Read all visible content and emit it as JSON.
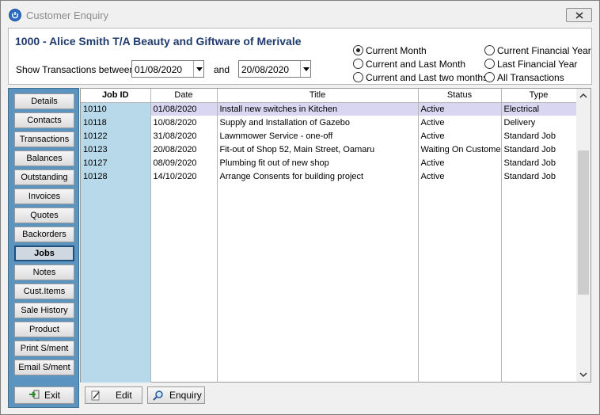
{
  "window": {
    "title": "Customer Enquiry"
  },
  "header": {
    "customer_title": "1000 - Alice Smith T/A Beauty and Giftware of Merivale",
    "show_label": "Show Transactions between",
    "from_date": "01/08/2020",
    "and_label": "and",
    "to_date": "20/08/2020"
  },
  "periods": [
    {
      "label": "Current Month",
      "selected": true
    },
    {
      "label": "Current and Last Month",
      "selected": false
    },
    {
      "label": "Current and Last two months",
      "selected": false
    },
    {
      "label": "Current Financial Year",
      "selected": false
    },
    {
      "label": "Last Financial Year",
      "selected": false
    },
    {
      "label": "All Transactions",
      "selected": false
    }
  ],
  "nav": {
    "items": [
      "Details",
      "Contacts",
      "Transactions",
      "Balances",
      "Outstanding",
      "Invoices",
      "Quotes",
      "Backorders",
      "Jobs",
      "Notes",
      "Cust.Items",
      "Sale History",
      "Product History",
      "Print S/ment",
      "Email S/ment"
    ],
    "active": "Jobs",
    "exit_label": "Exit"
  },
  "grid": {
    "columns": [
      "Job ID",
      "Date",
      "Title",
      "Status",
      "Type"
    ],
    "rows": [
      [
        "10110",
        "01/08/2020",
        "Install new switches in Kitchen",
        "Active",
        "Electrical"
      ],
      [
        "10118",
        "10/08/2020",
        "Supply and Installation of Gazebo",
        "Active",
        "Delivery"
      ],
      [
        "10122",
        "31/08/2020",
        "Lawnmower Service - one-off",
        "Active",
        "Standard Job"
      ],
      [
        "10123",
        "20/08/2020",
        "Fit-out of Shop 52, Main Street, Oamaru",
        "Waiting On Customer",
        "Standard Job"
      ],
      [
        "10127",
        "08/09/2020",
        "Plumbing fit out of new shop",
        "Active",
        "Standard Job"
      ],
      [
        "10128",
        "14/10/2020",
        "Arrange Consents for building project",
        "Active",
        "Standard Job"
      ]
    ],
    "selected_row": 0
  },
  "toolbar": {
    "edit_label": "Edit",
    "enquiry_label": "Enquiry"
  },
  "colors": {
    "accent": "#1f3a6d",
    "nav_bg": "#5b95bf",
    "jobid_col": "#b7d9ea",
    "selected_row": "#d9d6f2"
  }
}
